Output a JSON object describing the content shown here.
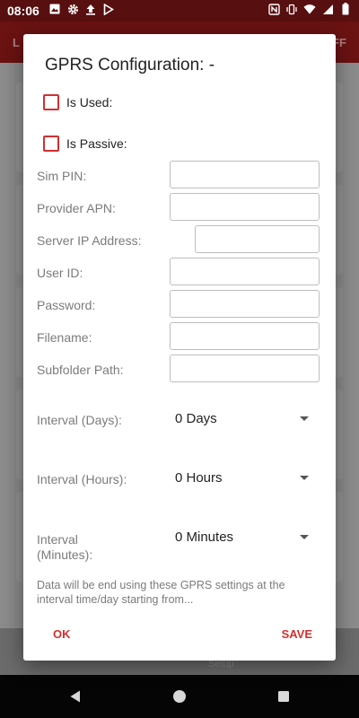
{
  "status_bar": {
    "time": "08:06",
    "left_icons": [
      "image-icon",
      "gear-icon",
      "upload-icon",
      "play-store-icon"
    ],
    "right_icons": [
      "nfc-icon",
      "vibrate-icon",
      "wifi-icon",
      "signal-icon",
      "battery-icon"
    ]
  },
  "background_app": {
    "app_bar_left": "L",
    "app_bar_right": "FF",
    "bottom_nav_label": "Setup"
  },
  "dialog": {
    "title": "GPRS Configuration: -",
    "checkboxes": [
      {
        "label": "Is Used:",
        "checked": false
      },
      {
        "label": "Is Passive:",
        "checked": false
      }
    ],
    "fields": [
      {
        "label": "Sim PIN:",
        "value": ""
      },
      {
        "label": "Provider APN:",
        "value": ""
      },
      {
        "label": "Server IP Address:",
        "value": ""
      },
      {
        "label": "User ID:",
        "value": ""
      },
      {
        "label": "Password:",
        "value": ""
      },
      {
        "label": "Filename:",
        "value": ""
      },
      {
        "label": "Subfolder Path:",
        "value": ""
      }
    ],
    "intervals": [
      {
        "label": "Interval (Days):",
        "value": "0 Days"
      },
      {
        "label": "Interval (Hours):",
        "value": "0 Hours"
      },
      {
        "label_line1": "Interval",
        "label_line2": "(Minutes):",
        "value": "0 Minutes"
      }
    ],
    "note": "Data will be end using these GPRS settings at the interval time/day starting from...",
    "ok_label": "OK",
    "save_label": "SAVE"
  },
  "colors": {
    "accent": "#d32f2f",
    "status_bar": "#580f0f",
    "label_gray": "#7b7b7b"
  }
}
